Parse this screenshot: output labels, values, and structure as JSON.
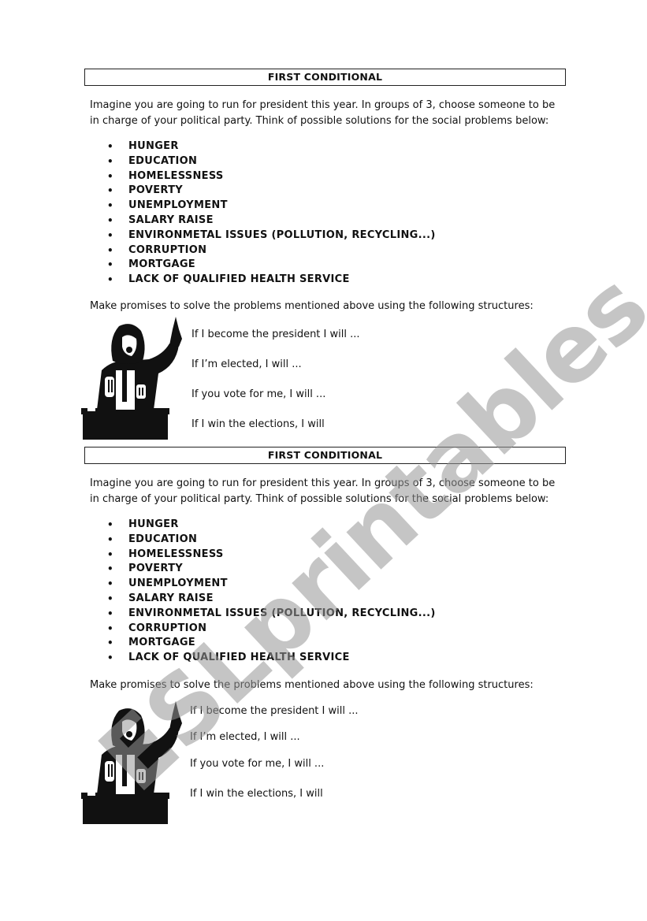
{
  "watermark": "ESLprintables.com",
  "sections": [
    {
      "title": "FIRST CONDITIONAL",
      "intro": "Imagine you are going to run for president this year. In groups of 3, choose someone to be in charge of your political party. Think of possible solutions for the social problems below:",
      "problems": [
        "HUNGER",
        "EDUCATION",
        "HOMELESSNESS",
        "POVERTY",
        "UNEMPLOYMENT",
        "SALARY RAISE",
        "ENVIRONMETAL ISSUES (POLLUTION, RECYCLING...)",
        "CORRUPTION",
        "MORTGAGE",
        "LACK OF QUALIFIED HEALTH SERVICE"
      ],
      "instruction": "Make promises to solve the problems mentioned above using the following structures:",
      "structures": [
        "If I become the president I will ...",
        "If I’m elected, I will ...",
        "If you vote for me, I will ...",
        "If I win the elections, I will"
      ],
      "image_alt": "politician-speaking-at-podium"
    },
    {
      "title": "FIRST CONDITIONAL",
      "intro": "Imagine you are going to run for president this year. In groups of 3, choose someone to be in charge of your political party. Think of possible solutions for the social problems below:",
      "problems": [
        "HUNGER",
        "EDUCATION",
        "HOMELESSNESS",
        "POVERTY",
        "UNEMPLOYMENT",
        "SALARY RAISE",
        "ENVIRONMETAL ISSUES (POLLUTION, RECYCLING...)",
        "CORRUPTION",
        "MORTGAGE",
        "LACK OF QUALIFIED HEALTH SERVICE"
      ],
      "instruction": "Make promises to solve the problems mentioned above using the following structures:",
      "structures": [
        "If I become the president I will ...",
        "If I’m elected, I will ...",
        "If you vote for me, I will ...",
        "If I win the elections, I will"
      ],
      "image_alt": "politician-speaking-at-podium"
    }
  ],
  "bullet_glyph": "•"
}
